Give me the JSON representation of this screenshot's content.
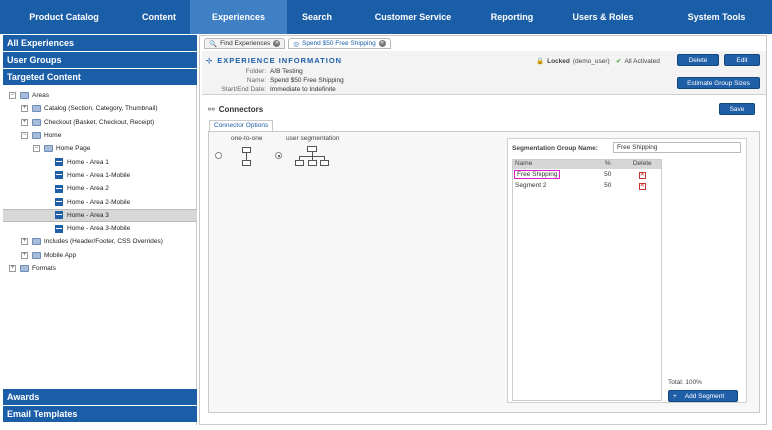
{
  "nav": {
    "items": [
      "Product Catalog",
      "Content",
      "Experiences",
      "Search",
      "Customer Service",
      "Reporting",
      "Users & Roles",
      "System Tools"
    ],
    "active": "Experiences"
  },
  "sidebar": {
    "all_experiences": "All Experiences",
    "user_groups": "User Groups",
    "targeted_content": "Targeted Content",
    "awards": "Awards",
    "email_templates": "Email Templates",
    "tree": [
      "Areas",
      "Catalog (Section, Category, Thumbnail)",
      "Checkout (Basket, Checkout, Receipt)",
      "Home",
      "Home Page",
      "Home - Area 1",
      "Home - Area 1-Mobile",
      "Home - Area 2",
      "Home - Area 2-Mobile",
      "Home - Area 3",
      "Home - Area 3-Mobile",
      "Includes (Header/Footer, CSS Overrides)",
      "Mobile App",
      "Formats"
    ]
  },
  "tabs": [
    "Find Experiences",
    "Spend $50 Free Shipping"
  ],
  "experience": {
    "title": "EXPERIENCE INFORMATION",
    "folder_label": "Folder:",
    "folder": "A/B Testing",
    "name_label": "Name:",
    "name": "Spend $50 Free Shipping",
    "dates_label": "Start/End Date:",
    "dates": "Immediate to Indefinite",
    "locked_label": "Locked",
    "locked_user": "(demo_user)",
    "activated": "All Activated",
    "delete": "Delete",
    "edit": "Edit",
    "estimate": "Estimate Group Sizes"
  },
  "connectors": {
    "title": "Connectors",
    "save": "Save",
    "tab": "Connector Options",
    "one_to_one": "one-to-one",
    "user_segmentation": "user segmentation",
    "selected": "user segmentation"
  },
  "segmentation": {
    "group_label": "Segmentation Group Name:",
    "group_name": "Free Shipping",
    "headers": [
      "Name",
      "%",
      "Delete"
    ],
    "rows": [
      {
        "name": "Free Shipping",
        "pct": "50"
      },
      {
        "name": "Segment 2",
        "pct": "50"
      }
    ],
    "total": "Total:  100%",
    "add": "Add Segment"
  }
}
